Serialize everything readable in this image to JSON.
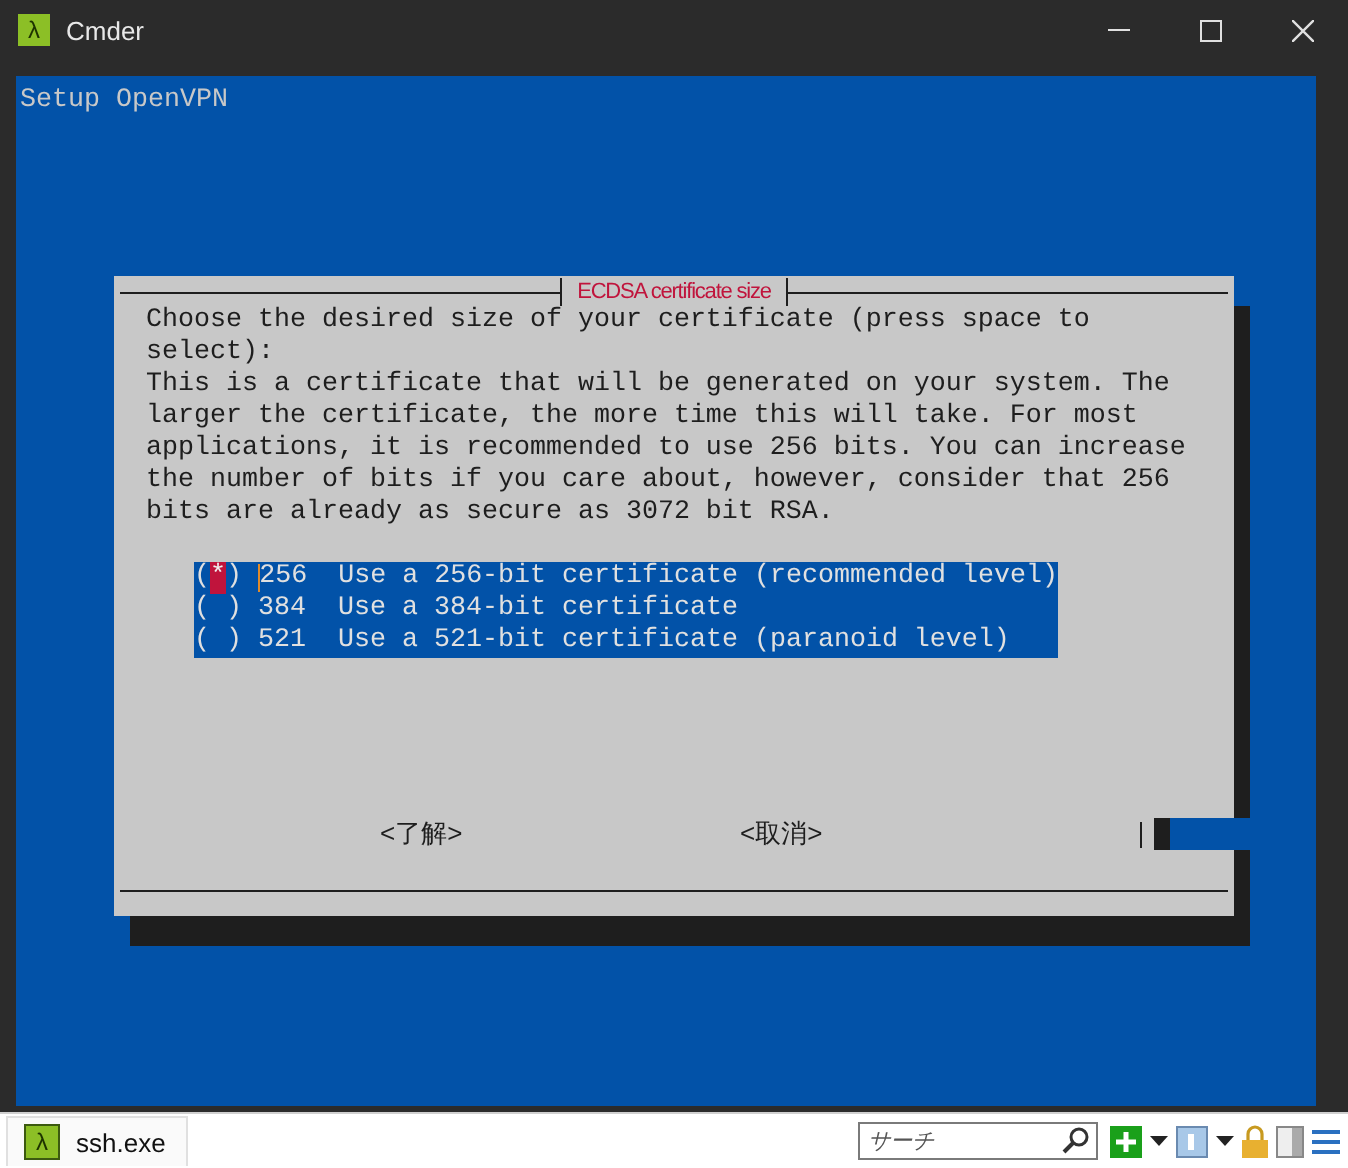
{
  "window": {
    "icon": "λ",
    "title": "Cmder"
  },
  "terminal": {
    "header": "Setup OpenVPN"
  },
  "dialog": {
    "title": "ECDSA certificate size",
    "prompt": "Choose the desired size of your certificate (press space to\nselect):",
    "description": "This is a certificate that will be generated on your system. The\nlarger the certificate, the more time this will take. For most\napplications, it is recommended to use 256 bits. You can increase\nthe number of bits if you care about, however, consider that 256\nbits are already as secure as 3072 bit RSA.",
    "radio": {
      "open": "(",
      "mark": "*",
      "close": ")"
    },
    "options": [
      {
        "value": "256",
        "description": "Use a 256-bit certificate (recommended level)",
        "selected": true
      },
      {
        "value": "384",
        "description": "Use a 384-bit certificate",
        "selected": false
      },
      {
        "value": "521",
        "description": "Use a 521-bit certificate (paranoid level)",
        "selected": false
      }
    ],
    "buttons": [
      "<了解>",
      "<取消>"
    ]
  },
  "status_bar": {
    "tab": {
      "icon": "λ",
      "label": "ssh.exe"
    },
    "search": {
      "placeholder": "サーチ"
    }
  }
}
